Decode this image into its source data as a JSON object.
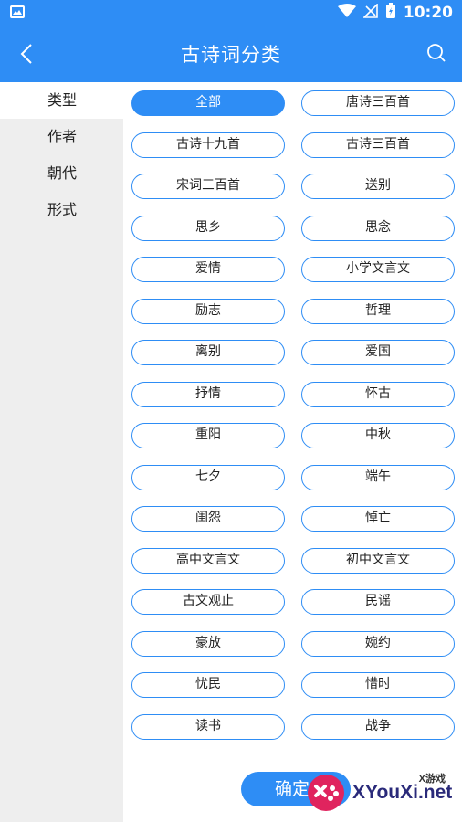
{
  "status_bar": {
    "time": "10:20"
  },
  "header": {
    "title": "古诗词分类"
  },
  "sidebar": {
    "items": [
      {
        "label": "类型"
      },
      {
        "label": "作者"
      },
      {
        "label": "朝代"
      },
      {
        "label": "形式"
      }
    ],
    "active_index": 0
  },
  "tags": [
    "全部",
    "唐诗三百首",
    "古诗十九首",
    "古诗三百首",
    "宋词三百首",
    "送别",
    "思乡",
    "思念",
    "爱情",
    "小学文言文",
    "励志",
    "哲理",
    "离别",
    "爱国",
    "抒情",
    "怀古",
    "重阳",
    "中秋",
    "七夕",
    "端午",
    "闺怨",
    "悼亡",
    "高中文言文",
    "初中文言文",
    "古文观止",
    "民谣",
    "豪放",
    "婉约",
    "忧民",
    "惜时",
    "读书",
    "战争"
  ],
  "selected_tag_index": 0,
  "footer": {
    "confirm_label": "确定"
  },
  "watermark": {
    "text": "XYouXi.net",
    "top_text": "X游戏"
  },
  "colors": {
    "accent": "#2e8df5",
    "sidebar_bg": "#eeeeee"
  }
}
